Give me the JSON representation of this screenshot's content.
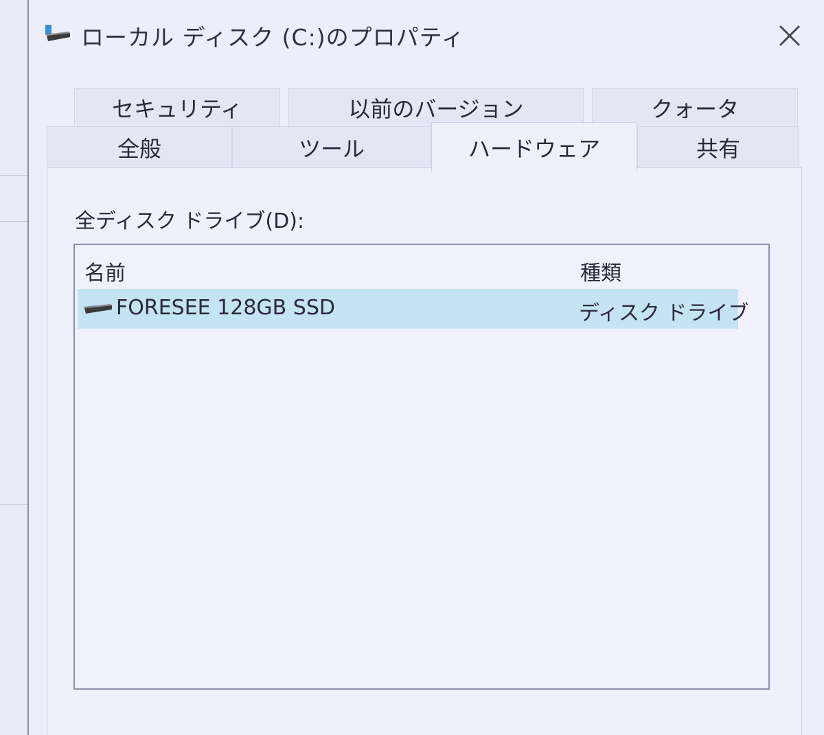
{
  "window": {
    "title": "ローカル ディスク (C:)のプロパティ",
    "title_icon": "drive-icon",
    "close_icon": "close-icon"
  },
  "tabs": {
    "row_back": [
      {
        "label": "セキュリティ"
      },
      {
        "label": "以前のバージョン"
      },
      {
        "label": "クォータ"
      }
    ],
    "row_front": [
      {
        "label": "全般"
      },
      {
        "label": "ツール"
      },
      {
        "label": "ハードウェア",
        "active": true
      },
      {
        "label": "共有"
      }
    ]
  },
  "hardware": {
    "list_label": "全ディスク ドライブ(D):",
    "columns": {
      "name": "名前",
      "type": "種類"
    },
    "devices": [
      {
        "name": "FORESEE 128GB SSD",
        "type": "ディスク ドライブ",
        "icon": "disk-drive-icon",
        "selected": true
      }
    ]
  },
  "colors": {
    "selection": "#c4e3f3",
    "background": "#eceef9",
    "border": "#8b90a8"
  }
}
